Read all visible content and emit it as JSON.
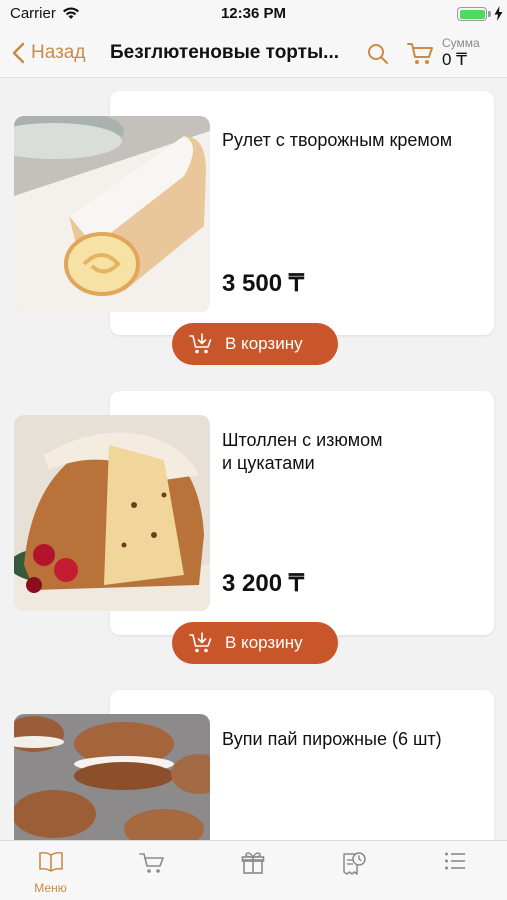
{
  "status_bar": {
    "carrier": "Carrier",
    "time": "12:36 PM"
  },
  "nav": {
    "back_label": "Назад",
    "title": "Безглютеновые торты...",
    "sum_label": "Сумма",
    "sum_value": "0 ₸",
    "accent_color": "#c98b4a"
  },
  "products": [
    {
      "title": "Рулет с творожным кремом",
      "price": "3 500 ₸",
      "cart_button": "В корзину",
      "image": "swiss-roll-cake"
    },
    {
      "title": "Штоллен с изюмом\nи цукатами",
      "price": "3 200 ₸",
      "cart_button": "В корзину",
      "image": "stollen-cake"
    },
    {
      "title": "Вупи пай пирожные (6 шт)",
      "price": "",
      "cart_button": "",
      "image": "whoopie-pies"
    }
  ],
  "tab_bar": {
    "tabs": [
      {
        "label": "Меню",
        "icon": "book-icon",
        "active": true
      },
      {
        "label": "",
        "icon": "cart-icon",
        "active": false
      },
      {
        "label": "",
        "icon": "gift-icon",
        "active": false
      },
      {
        "label": "",
        "icon": "order-history-icon",
        "active": false
      },
      {
        "label": "",
        "icon": "list-icon",
        "active": false
      }
    ]
  },
  "colors": {
    "button": "#c9562a",
    "accent": "#c98b4a",
    "background": "#f2f2f2"
  }
}
